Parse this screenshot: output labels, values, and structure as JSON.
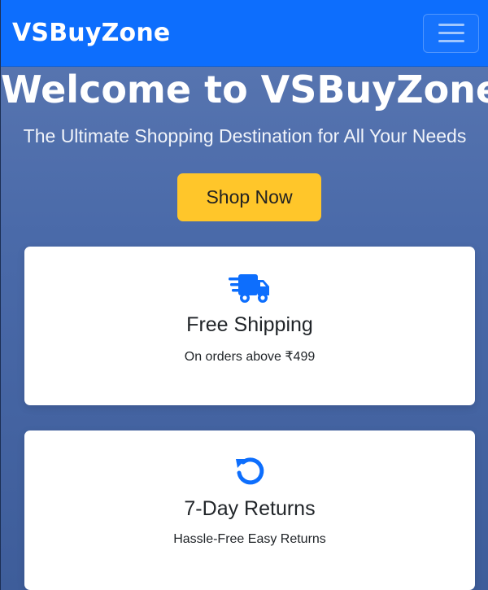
{
  "navbar": {
    "brand": "VSBuyZone",
    "brand_color": "#0d6efd"
  },
  "hero": {
    "title": "Welcome to VSBuyZone",
    "subtitle": "The Ultimate Shopping Destination for All Your Needs",
    "cta_label": "Shop Now",
    "cta_color": "#ffc62a"
  },
  "features": [
    {
      "icon": "truck-fast-icon",
      "title": "Free Shipping",
      "text": "On orders above ₹499"
    },
    {
      "icon": "rotate-left-icon",
      "title": "7-Day Returns",
      "text": "Hassle-Free Easy Returns"
    }
  ]
}
